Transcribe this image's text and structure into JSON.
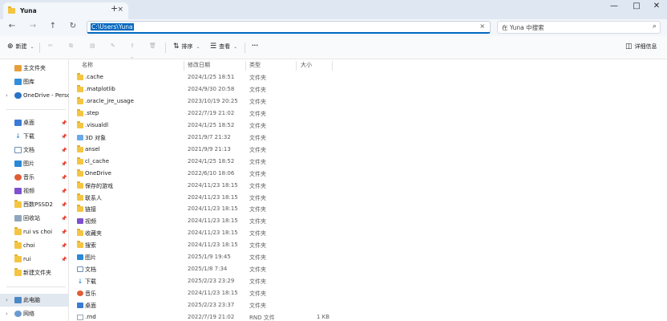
{
  "window": {
    "tab_title": "Yuna",
    "tab_close": "×",
    "new_tab": "+",
    "minimize": "—",
    "maximize": "□",
    "close": "✕"
  },
  "address": {
    "back": "←",
    "forward": "→",
    "up": "↑",
    "refresh": "↻",
    "path": "C:\\Users\\Yuna",
    "clear": "×",
    "search_placeholder": "在 Yuna 中搜索"
  },
  "toolbar": {
    "new_label": "新建",
    "sort_label": "排序",
    "view_label": "查看",
    "more": "···",
    "details_label": "详细信息"
  },
  "sidebar": {
    "items": [
      {
        "label": "主文件夹",
        "icon": "home-icon",
        "chevron": "",
        "pinned": false
      },
      {
        "label": "图库",
        "icon": "gallery-icon",
        "chevron": "",
        "pinned": false
      },
      {
        "label": "OneDrive - Persona",
        "icon": "cloud-icon",
        "chevron": "›",
        "pinned": false
      },
      {
        "label": "桌面",
        "icon": "desktop-icon",
        "chevron": "",
        "pinned": true
      },
      {
        "label": "下载",
        "icon": "download-icon",
        "chevron": "",
        "pinned": true
      },
      {
        "label": "文档",
        "icon": "document-icon",
        "chevron": "",
        "pinned": true
      },
      {
        "label": "图片",
        "icon": "picture-icon",
        "chevron": "",
        "pinned": true
      },
      {
        "label": "音乐",
        "icon": "music-icon",
        "chevron": "",
        "pinned": true
      },
      {
        "label": "视频",
        "icon": "video-icon",
        "chevron": "",
        "pinned": true
      },
      {
        "label": "西数PSSD2",
        "icon": "folder-icon",
        "chevron": "",
        "pinned": true
      },
      {
        "label": "回收站",
        "icon": "recycle-bin-icon",
        "chevron": "",
        "pinned": true
      },
      {
        "label": "rui vs choi",
        "icon": "folder-icon",
        "chevron": "",
        "pinned": true
      },
      {
        "label": "choi",
        "icon": "folder-icon",
        "chevron": "",
        "pinned": true
      },
      {
        "label": "rui",
        "icon": "folder-icon",
        "chevron": "",
        "pinned": true
      },
      {
        "label": "新建文件夹",
        "icon": "folder-icon",
        "chevron": "",
        "pinned": false
      },
      {
        "label": "此电脑",
        "icon": "computer-icon",
        "chevron": "›",
        "pinned": false
      },
      {
        "label": "网络",
        "icon": "network-icon",
        "chevron": "›",
        "pinned": false
      }
    ]
  },
  "columns": {
    "name": "名称",
    "date": "修改日期",
    "type": "类型",
    "size": "大小"
  },
  "files": [
    {
      "name": ".cache",
      "date": "2024/1/25 18:51",
      "type": "文件夹",
      "size": "",
      "icon": "folder"
    },
    {
      "name": ".matplotlib",
      "date": "2024/9/30 20:58",
      "type": "文件夹",
      "size": "",
      "icon": "folder"
    },
    {
      "name": ".oracle_jre_usage",
      "date": "2023/10/19 20:25",
      "type": "文件夹",
      "size": "",
      "icon": "folder"
    },
    {
      "name": ".step",
      "date": "2022/7/19 21:02",
      "type": "文件夹",
      "size": "",
      "icon": "folder"
    },
    {
      "name": ".visualdl",
      "date": "2024/1/25 18:52",
      "type": "文件夹",
      "size": "",
      "icon": "folder"
    },
    {
      "name": "3D 对象",
      "date": "2021/9/7 21:32",
      "type": "文件夹",
      "size": "",
      "icon": "cube"
    },
    {
      "name": "ansel",
      "date": "2021/9/9 21:13",
      "type": "文件夹",
      "size": "",
      "icon": "folder"
    },
    {
      "name": "cl_cache",
      "date": "2024/1/25 18:52",
      "type": "文件夹",
      "size": "",
      "icon": "folder"
    },
    {
      "name": "OneDrive",
      "date": "2022/6/10 18:06",
      "type": "文件夹",
      "size": "",
      "icon": "folder"
    },
    {
      "name": "保存的游戏",
      "date": "2024/11/23 18:15",
      "type": "文件夹",
      "size": "",
      "icon": "folder"
    },
    {
      "name": "联系人",
      "date": "2024/11/23 18:15",
      "type": "文件夹",
      "size": "",
      "icon": "folder"
    },
    {
      "name": "链接",
      "date": "2024/11/23 18:15",
      "type": "文件夹",
      "size": "",
      "icon": "folder"
    },
    {
      "name": "视频",
      "date": "2024/11/23 18:15",
      "type": "文件夹",
      "size": "",
      "icon": "video"
    },
    {
      "name": "收藏夹",
      "date": "2024/11/23 18:15",
      "type": "文件夹",
      "size": "",
      "icon": "folder"
    },
    {
      "name": "搜索",
      "date": "2024/11/23 18:15",
      "type": "文件夹",
      "size": "",
      "icon": "folder"
    },
    {
      "name": "图片",
      "date": "2025/1/9 19:45",
      "type": "文件夹",
      "size": "",
      "icon": "pic"
    },
    {
      "name": "文档",
      "date": "2025/1/8 7:34",
      "type": "文件夹",
      "size": "",
      "icon": "doc"
    },
    {
      "name": "下载",
      "date": "2025/2/23 23:29",
      "type": "文件夹",
      "size": "",
      "icon": "down"
    },
    {
      "name": "音乐",
      "date": "2024/11/23 18:15",
      "type": "文件夹",
      "size": "",
      "icon": "music"
    },
    {
      "name": "桌面",
      "date": "2025/2/23 23:37",
      "type": "文件夹",
      "size": "",
      "icon": "desk"
    },
    {
      "name": ".rnd",
      "date": "2022/7/19 21:02",
      "type": "RND 文件",
      "size": "1 KB",
      "icon": "file"
    }
  ]
}
